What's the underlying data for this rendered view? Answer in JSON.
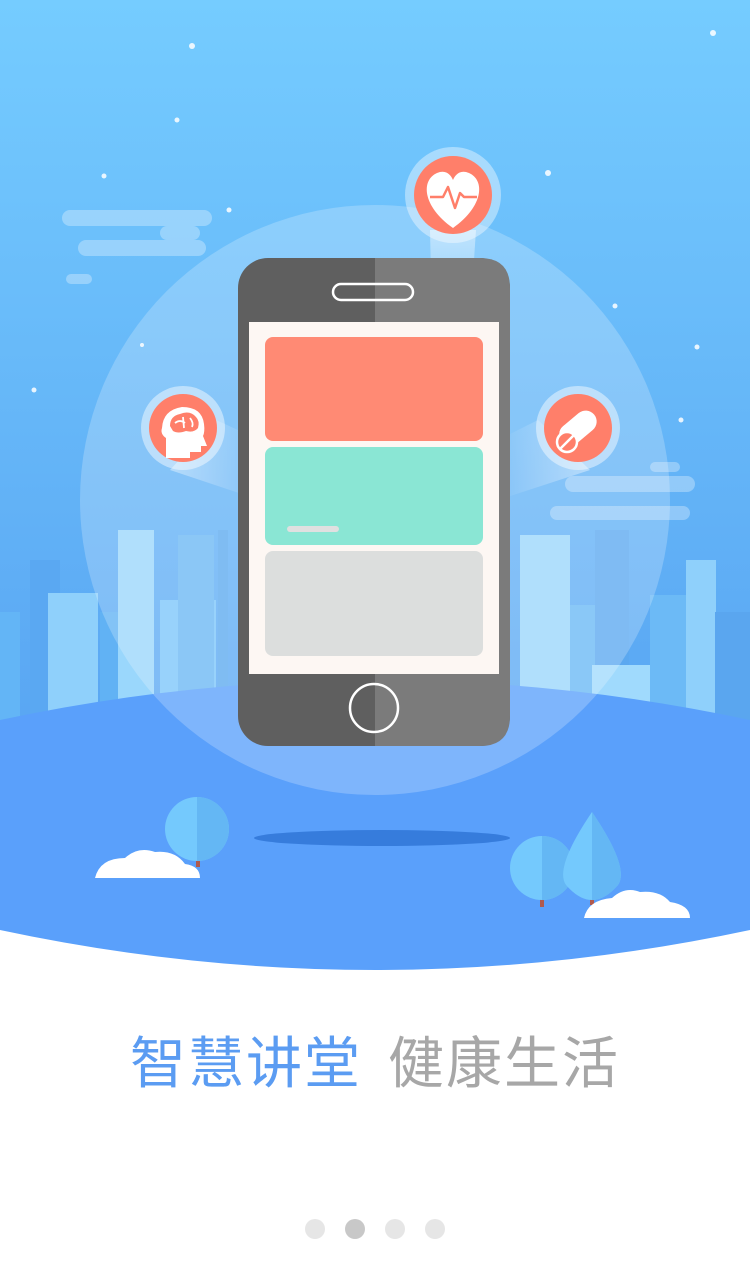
{
  "slogan": {
    "primary": "智慧讲堂",
    "secondary": "健康生活"
  },
  "pager": {
    "count": 4,
    "active_index": 1
  },
  "illustration": {
    "icons": [
      "heart-pulse-icon",
      "brain-head-icon",
      "pill-icon"
    ]
  },
  "colors": {
    "sky_top": "#75ccff",
    "sky_bottom": "#4f9af1",
    "ground": "#5aa0fb",
    "slogan_primary": "#5b9cf2",
    "slogan_secondary": "#a7a7a7",
    "card_red": "#ff8a74",
    "card_green": "#8ae6d4",
    "card_gray": "#dcdedd",
    "badge": "#ff7f6a"
  }
}
